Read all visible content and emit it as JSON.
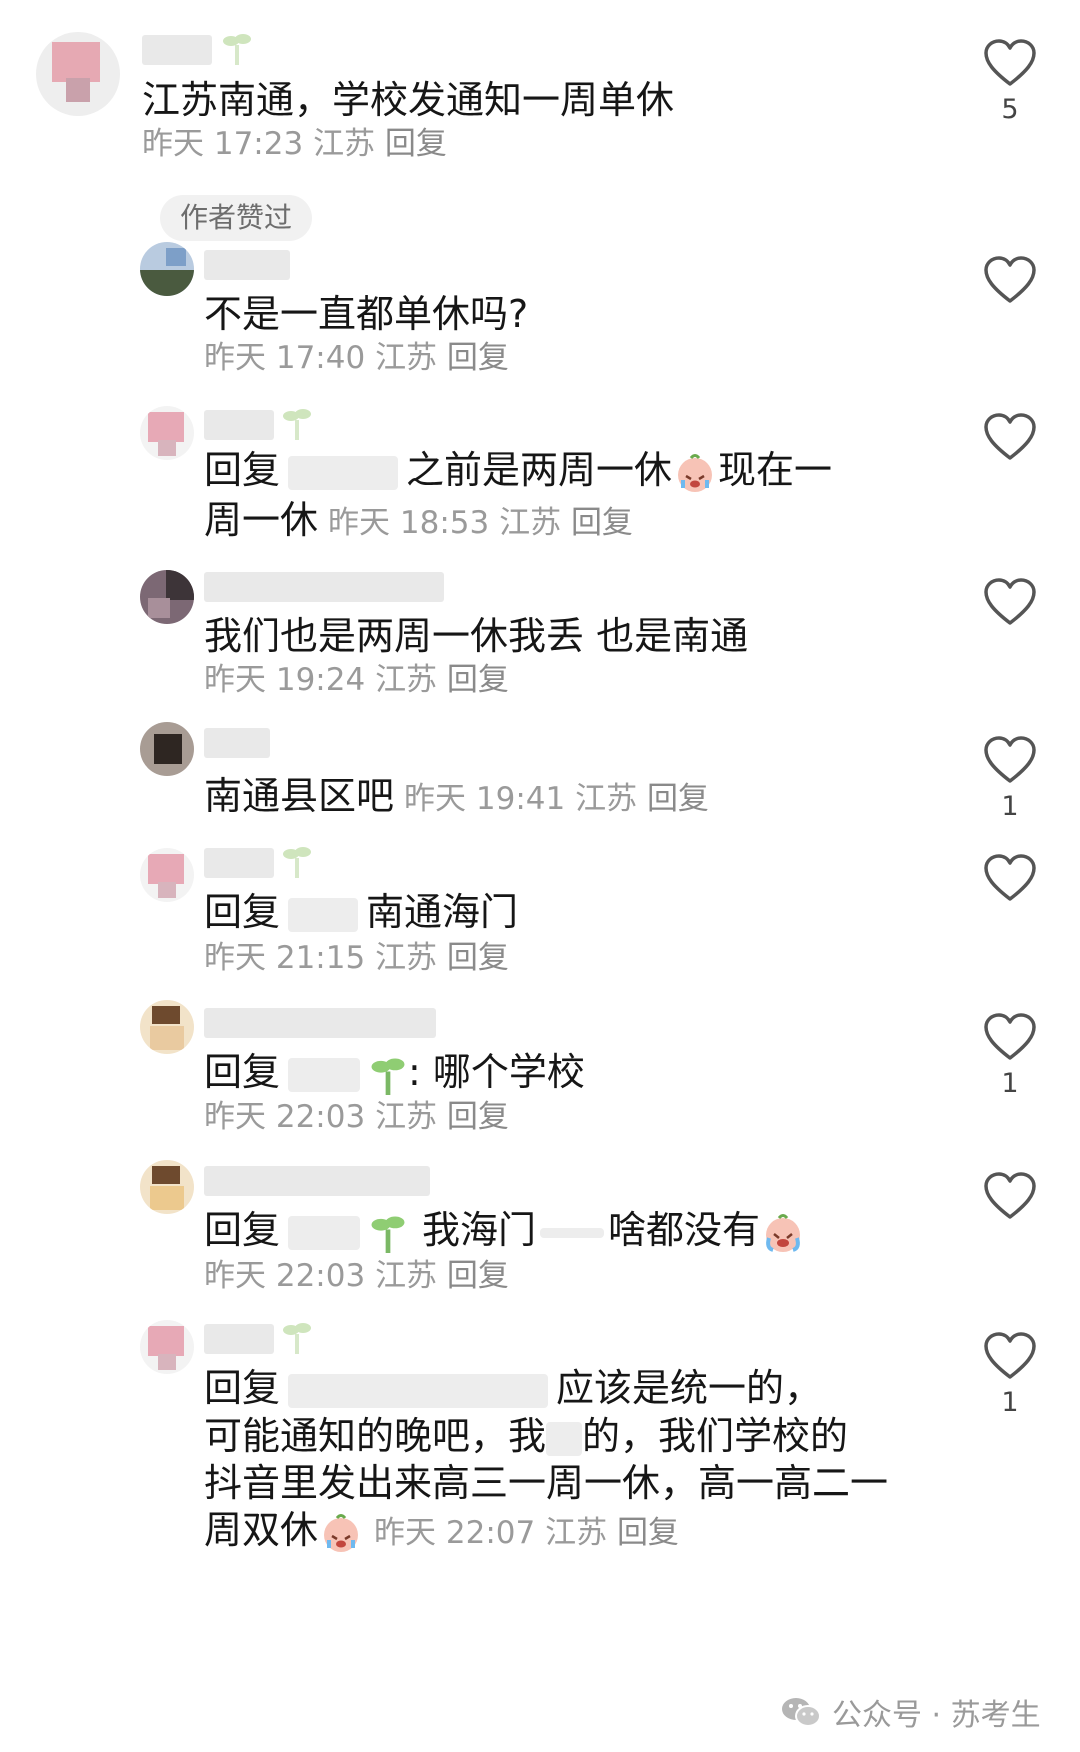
{
  "c1": {
    "text": "江苏南通，学校发通知一周单休",
    "time": "昨天 17:23",
    "loc": "江苏",
    "reply": "回复",
    "badge": "作者赞过",
    "likes": "5"
  },
  "c2": {
    "text": "不是一直都单休吗?",
    "time": "昨天 17:40",
    "loc": "江苏",
    "reply": "回复"
  },
  "c3": {
    "prefix": "回复",
    "text1": "之前是两周一休",
    "text2": "现在一",
    "text3": "周一休",
    "time": "昨天 18:53",
    "loc": "江苏",
    "reply": "回复",
    "emoji": "crying-face"
  },
  "c4": {
    "text": "我们也是两周一休我丢 也是南通",
    "time": "昨天 19:24",
    "loc": "江苏",
    "reply": "回复"
  },
  "c5": {
    "text": "南通县区吧",
    "time": "昨天 19:41",
    "loc": "江苏",
    "reply": "回复",
    "likes": "1"
  },
  "c6": {
    "prefix": "回复",
    "text": "南通海门",
    "time": "昨天 21:15",
    "loc": "江苏",
    "reply": "回复"
  },
  "c7": {
    "prefix": "回复",
    "colon": ":",
    "text": "哪个学校",
    "time": "昨天 22:03",
    "loc": "江苏",
    "reply": "回复",
    "likes": "1"
  },
  "c8": {
    "prefix": "回复",
    "text1": "我海门",
    "text2": "啥都没有",
    "time": "昨天 22:03",
    "loc": "江苏",
    "reply": "回复",
    "emoji": "crying-face"
  },
  "c9": {
    "prefix": "回复",
    "line1": "应该是统一的，",
    "line2a": "可能通知的晚吧，我",
    "line2b": "的，我们学校的",
    "line3": "抖音里发出来高三一周一休，高一高二一",
    "line4": "周双休",
    "time": "昨天 22:07",
    "loc": "江苏",
    "reply": "回复",
    "likes": "1",
    "emoji": "crying-face"
  },
  "watermark": {
    "text": "公众号 · 苏考生",
    "icon": "wechat-icon"
  },
  "colors": {
    "text": "#161616",
    "meta": "#9a9a9a",
    "heart": "#555555"
  }
}
